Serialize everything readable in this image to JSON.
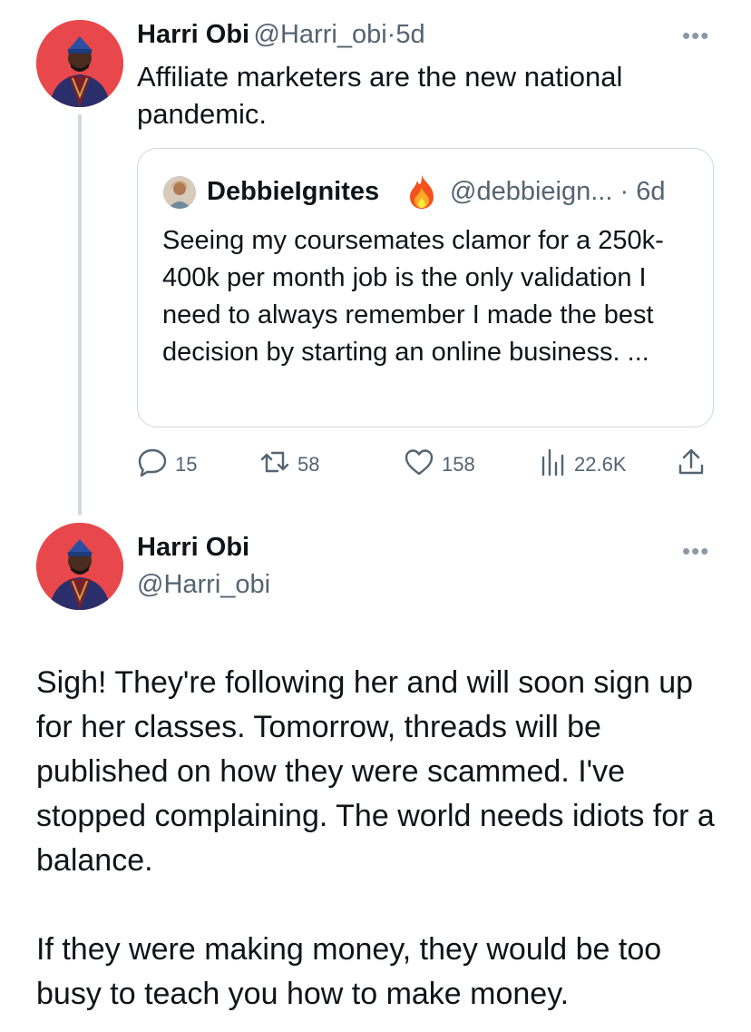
{
  "tweet1": {
    "author_name": "Harri Obi",
    "handle": "@Harri_obi",
    "separator": "·",
    "time": "5d",
    "text": "Affiliate marketers are the new national pandemic.",
    "more_icon": "more-horizontal-icon",
    "quote": {
      "author_name": "DebbieIgnites",
      "emoji": "fire-emoji",
      "handle": "@debbieign...",
      "separator": "·",
      "time": "6d",
      "text": "Seeing my coursemates clamor for a 250k-400k per month job is the only validation I need to always remember I made the best decision by starting an online business. ..."
    },
    "actions": {
      "replies": "15",
      "retweets": "58",
      "likes": "158",
      "views": "22.6K"
    }
  },
  "tweet2": {
    "author_name": "Harri Obi",
    "handle": "@Harri_obi",
    "paragraph1": "Sigh! They're following her and will soon sign up for her classes. Tomorrow, threads will be published on how they were scammed. I've stopped complaining. The world needs idiots for a balance.",
    "paragraph2": "If they were making money, they would be too busy to teach you how to make money."
  },
  "colors": {
    "text": "#0f1419",
    "secondary": "#536471",
    "border": "#cfd9de",
    "avatar_bg": "#e8484c"
  }
}
